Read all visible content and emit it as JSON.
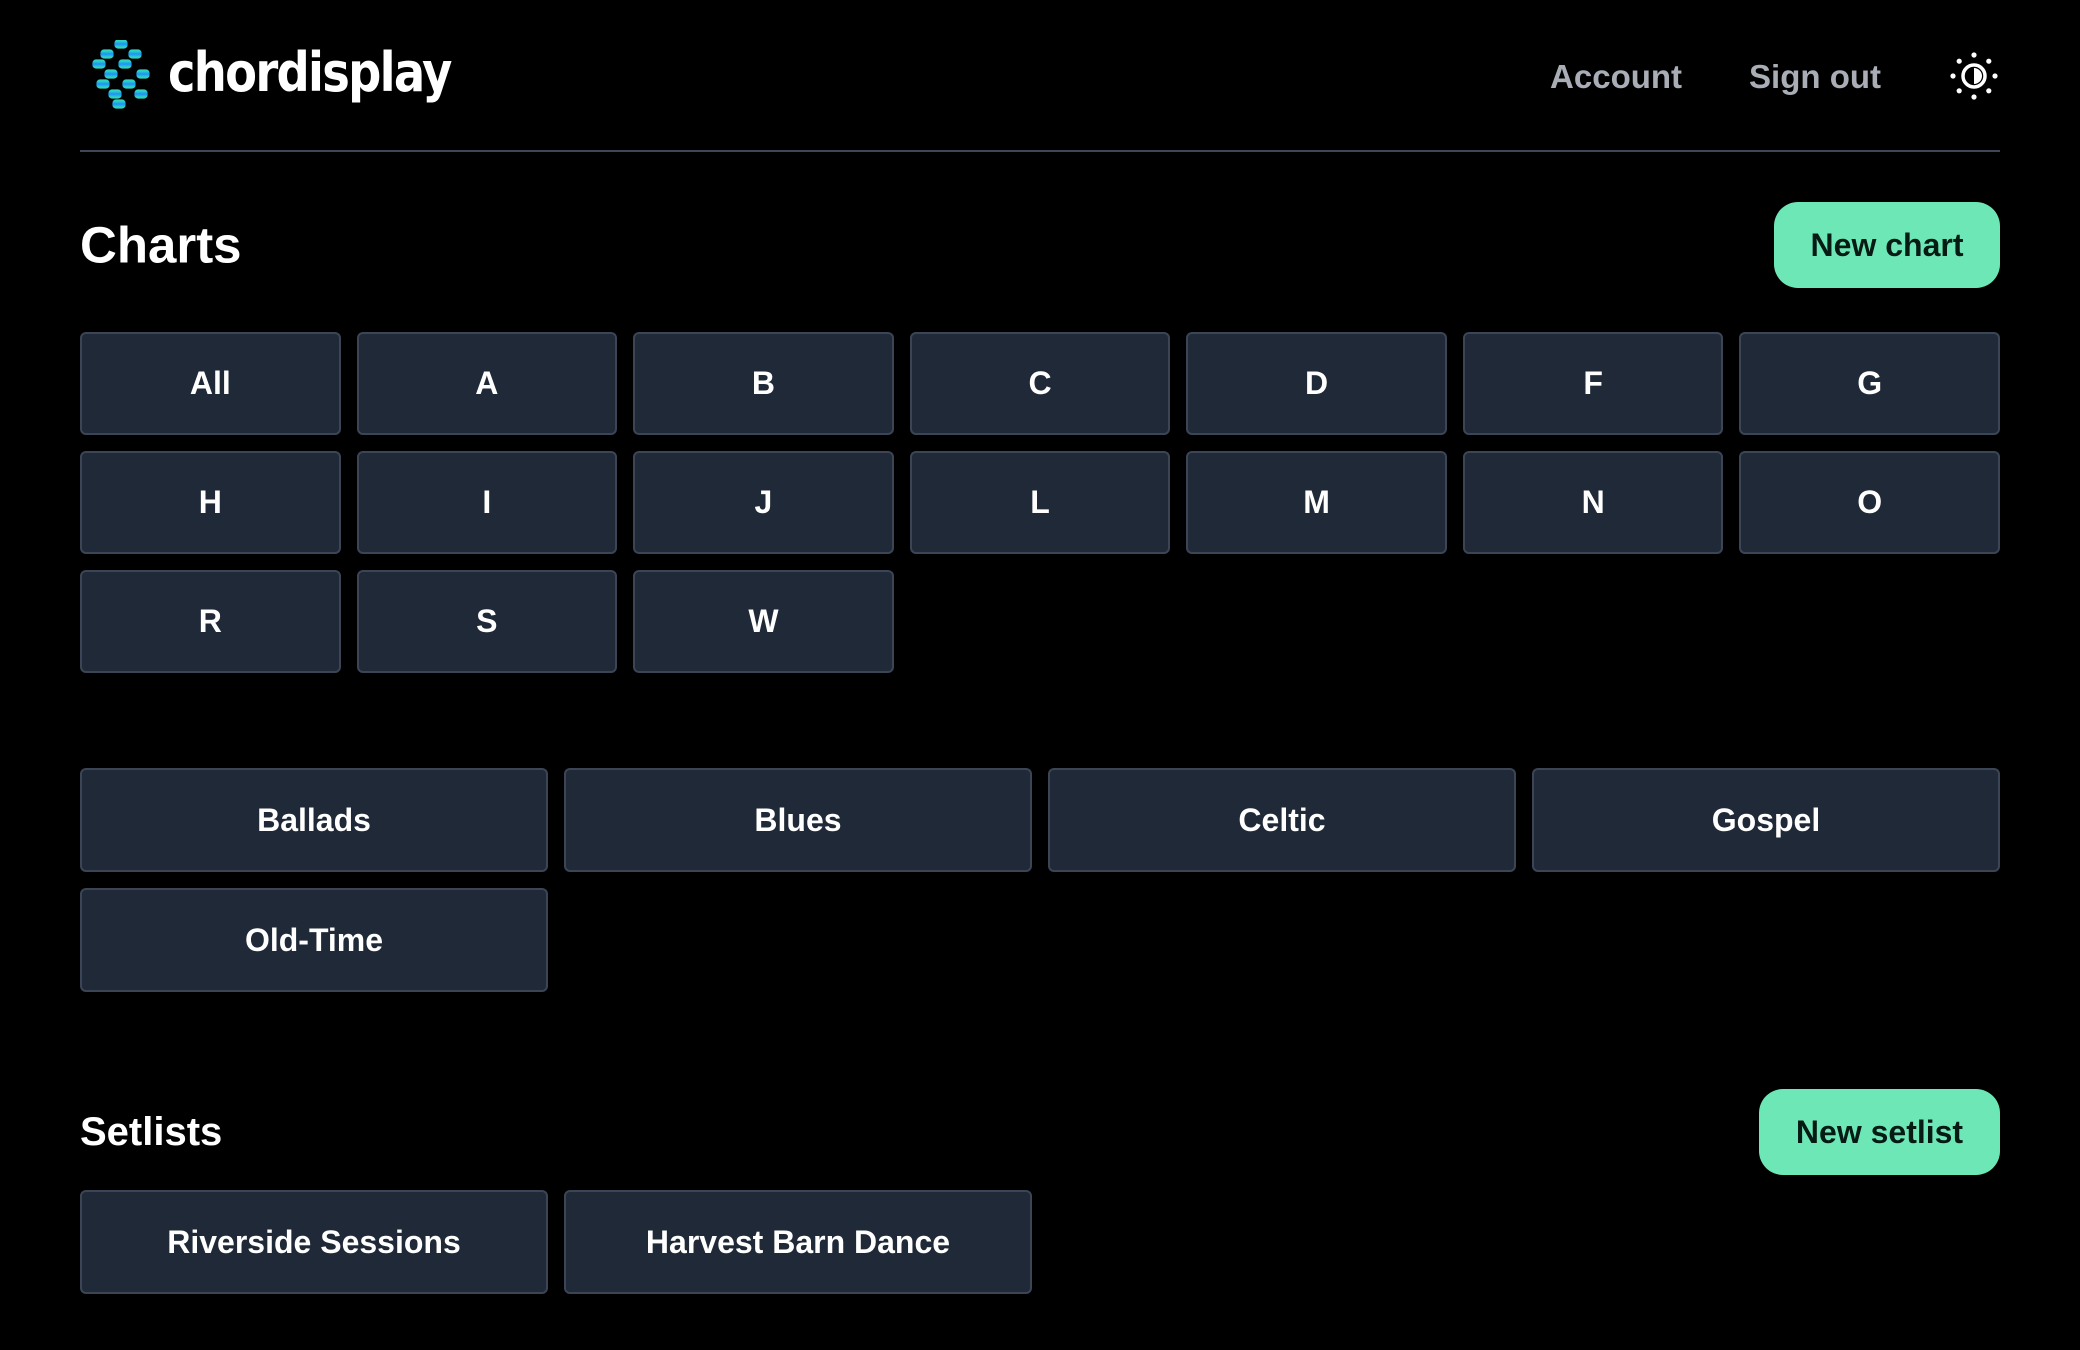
{
  "header": {
    "logo_text": "chordisplay",
    "nav": {
      "account_label": "Account",
      "signout_label": "Sign out"
    },
    "theme_icon": "sun-icon"
  },
  "charts": {
    "title": "Charts",
    "new_button_label": "New chart",
    "letters": [
      "All",
      "A",
      "B",
      "C",
      "D",
      "F",
      "G",
      "H",
      "I",
      "J",
      "L",
      "M",
      "N",
      "O",
      "R",
      "S",
      "W"
    ],
    "genres": [
      "Ballads",
      "Blues",
      "Celtic",
      "Gospel",
      "Old-Time"
    ]
  },
  "setlists": {
    "title": "Setlists",
    "new_button_label": "New setlist",
    "items": [
      "Riverside Sessions",
      "Harvest Barn Dance"
    ]
  },
  "colors": {
    "background": "#000000",
    "tile_bg": "#1f2937",
    "tile_border": "#3c4556",
    "accent": "#6ee7b7",
    "nav_text": "#a8adb6",
    "logo_gradient": [
      "#1e90ff",
      "#2dd4bf"
    ]
  }
}
